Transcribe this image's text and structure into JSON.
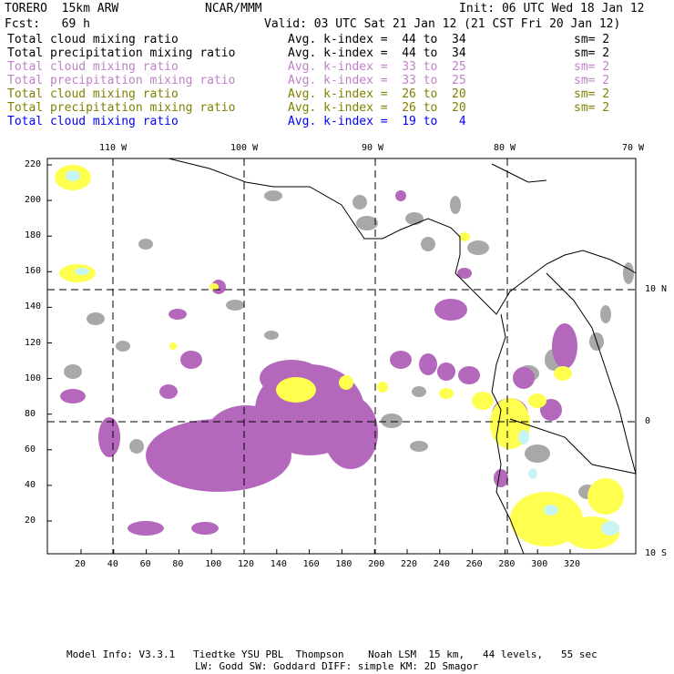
{
  "header": {
    "model": "TORERO  15km ARW",
    "org": "NCAR/MMM",
    "init": "Init: 06 UTC Wed 18 Jan 12",
    "fcst": "Fcst:   69 h",
    "valid": "Valid: 03 UTC Sat 21 Jan 12 (21 CST Fri 20 Jan 12)"
  },
  "legend": [
    {
      "field": "Total cloud mixing ratio",
      "range": "Avg. k-index =  44 to  34",
      "sm": "sm= 2",
      "color": "#000000"
    },
    {
      "field": "Total precipitation mixing ratio",
      "range": "Avg. k-index =  44 to  34",
      "sm": "sm= 2",
      "color": "#000000"
    },
    {
      "field": "Total cloud mixing ratio",
      "range": "Avg. k-index =  33 to  25",
      "sm": "sm= 2",
      "color": "#c080c8"
    },
    {
      "field": "Total precipitation mixing ratio",
      "range": "Avg. k-index =  33 to  25",
      "sm": "sm= 2",
      "color": "#c080c8"
    },
    {
      "field": "Total cloud mixing ratio",
      "range": "Avg. k-index =  26 to  20",
      "sm": "sm= 2",
      "color": "#808000"
    },
    {
      "field": "Total precipitation mixing ratio",
      "range": "Avg. k-index =  26 to  20",
      "sm": "sm= 2",
      "color": "#808000"
    },
    {
      "field": "Total cloud mixing ratio",
      "range": "Avg. k-index =  19 to   4",
      "sm": "",
      "color": "#0000ff"
    }
  ],
  "map": {
    "lon_labels": [
      "110 W",
      "100 W",
      "90 W",
      "80 W",
      "70 W"
    ],
    "lat_labels": [
      "10 N",
      "0",
      "10 S"
    ],
    "y_ticks": [
      "220",
      "200",
      "180",
      "160",
      "140",
      "120",
      "100",
      "80",
      "60",
      "40",
      "20"
    ],
    "x_ticks": [
      "20",
      "40",
      "60",
      "80",
      "100",
      "120",
      "140",
      "160",
      "180",
      "200",
      "220",
      "240",
      "260",
      "280",
      "300",
      "320"
    ],
    "colors": {
      "gray": "#a8a8a8",
      "purple": "#b468bc",
      "yellow": "#ffff50",
      "cyan": "#c8f4f4"
    }
  },
  "footer": {
    "line1": "Model Info: V3.3.1   Tiedtke YSU PBL  Thompson    Noah LSM  15 km,   44 levels,   55 sec",
    "line2": "LW: Godd SW: Goddard DIFF: simple KM: 2D Smagor"
  }
}
